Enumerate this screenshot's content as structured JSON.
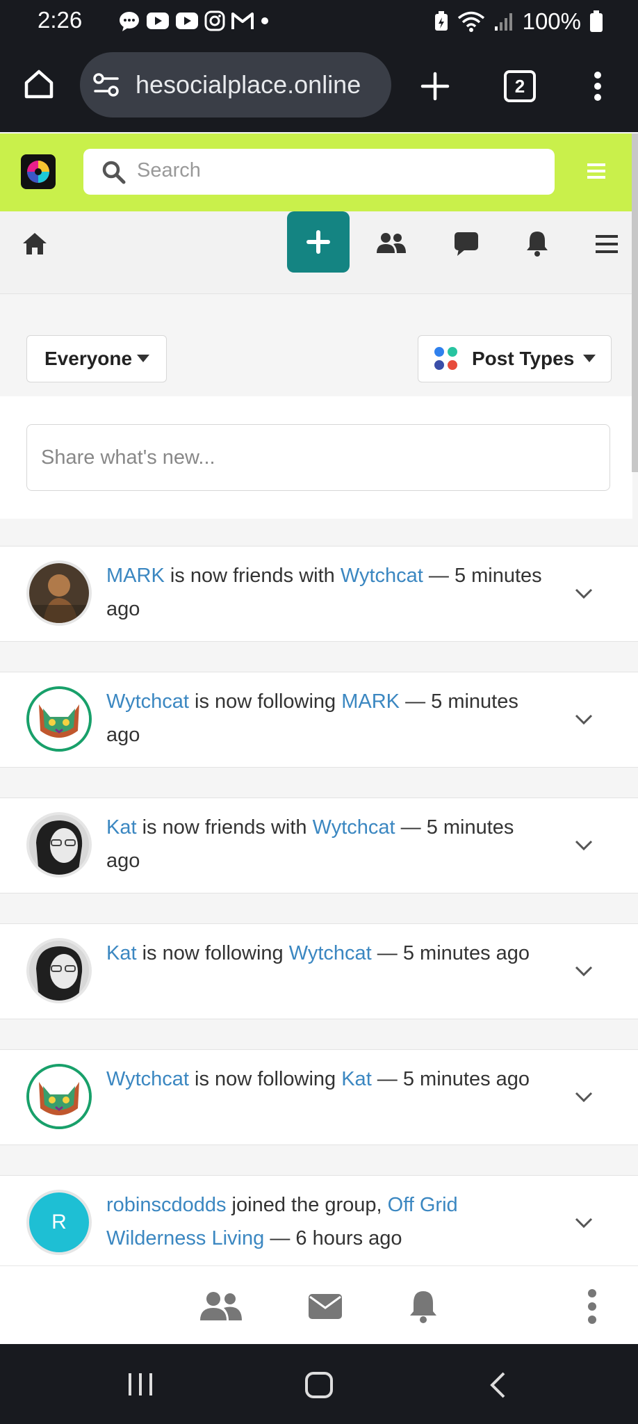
{
  "status_bar": {
    "time": "2:26",
    "battery": "100%",
    "notif_icons": [
      "chat-bubble-icon",
      "youtube-icon",
      "youtube-icon",
      "instagram-icon",
      "gmail-icon",
      "dot-icon"
    ]
  },
  "browser": {
    "url": "hesocialplace.online",
    "tab_count": "2"
  },
  "header": {
    "search_placeholder": "Search"
  },
  "filters": {
    "audience": "Everyone",
    "post_types": "Post Types",
    "post_types_dot_colors": [
      "#2f80ed",
      "#27c4a0",
      "#e74c3c",
      "#3b4ea8"
    ]
  },
  "composer": {
    "placeholder": "Share what's new..."
  },
  "feed": [
    {
      "actor": "MARK",
      "verb": " is now friends with ",
      "target": "Wytchcat",
      "suffix": " — 5 minutes ago"
    },
    {
      "actor": "Wytchcat",
      "verb": " is now following ",
      "target": "MARK",
      "suffix": " — 5 minutes ago"
    },
    {
      "actor": "Kat",
      "verb": " is now friends with ",
      "target": "Wytchcat",
      "suffix": " — 5 minutes ago"
    },
    {
      "actor": "Kat",
      "verb": " is now following ",
      "target": "Wytchcat",
      "suffix": " — 5 minutes ago"
    },
    {
      "actor": "Wytchcat",
      "verb": " is now following ",
      "target": "Kat",
      "suffix": " — 5 minutes ago"
    },
    {
      "actor": "robinscdodds",
      "verb": " joined the group, ",
      "target": "Off Grid Wilderness Living",
      "suffix": " — 6 hours ago",
      "avatar_letter": "R"
    }
  ],
  "colors": {
    "header_bg": "#c9f04b",
    "accent": "#148482",
    "link": "#3b87c1",
    "avatar_teal": "#1ebfd4",
    "avatar_ring_green": "#18a06a"
  }
}
